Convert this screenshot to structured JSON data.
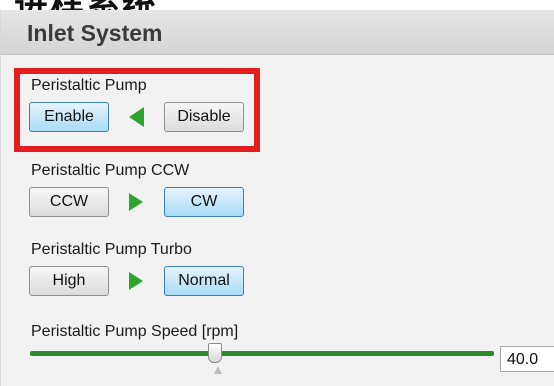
{
  "header_text": "进样系统",
  "panel": {
    "title": "Inlet System"
  },
  "pump": {
    "label": "Peristaltic Pump",
    "enable": "Enable",
    "disable": "Disable",
    "arrow": "arrow-left-icon"
  },
  "direction": {
    "label": "Peristaltic Pump CCW",
    "ccw": "CCW",
    "cw": "CW",
    "arrow": "arrow-right-icon"
  },
  "turbo": {
    "label": "Peristaltic Pump Turbo",
    "high": "High",
    "normal": "Normal",
    "arrow": "arrow-right-icon"
  },
  "speed": {
    "label": "Peristaltic Pump Speed [rpm]",
    "value": "40.0"
  },
  "colors": {
    "accent_green": "#2ea42e",
    "highlight_red": "#e31e1e",
    "active_blue": "#a9dbf6"
  }
}
